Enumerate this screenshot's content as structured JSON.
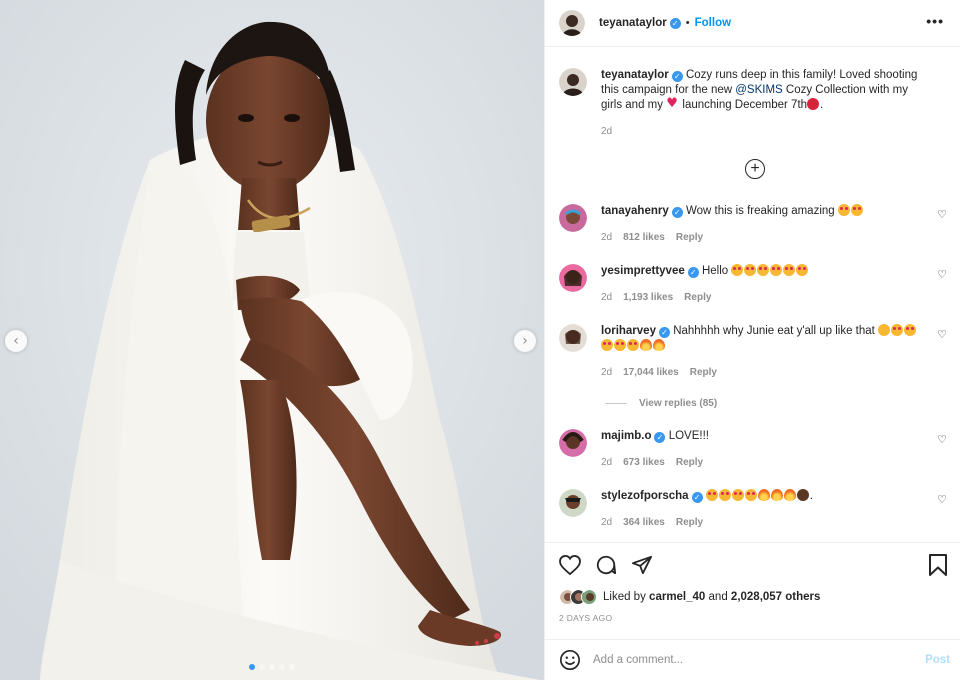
{
  "post": {
    "username": "teyanataylor",
    "follow_label": "Follow",
    "more_label": "•••"
  },
  "caption": {
    "username": "teyanataylor",
    "text_before": "Cozy runs deep in this family! Loved shooting this campaign for the new ",
    "mention": "@SKIMS",
    "text_middle": " Cozy Collection with my girls and my ",
    "text_after": " launching December 7th",
    "end_punct": ".",
    "time": "2d"
  },
  "comments": [
    {
      "username": "tanayahenry",
      "text": "Wow this is freaking amazing",
      "emoji": [
        "star-struck",
        "star-struck"
      ],
      "time": "2d",
      "likes": "812 likes",
      "reply": "Reply"
    },
    {
      "username": "yesimprettyvee",
      "text": "Hello",
      "emoji": [
        "star-struck",
        "star-struck",
        "star-struck",
        "star-struck",
        "star-struck",
        "star-struck"
      ],
      "time": "2d",
      "likes": "1,193 likes",
      "reply": "Reply"
    },
    {
      "username": "loriharvey",
      "text": "Nahhhhh why Junie eat y'all up like that",
      "emoji": [
        "astonished",
        "star-struck",
        "star-struck",
        "star-struck",
        "star-struck",
        "star-struck",
        "fire",
        "fire"
      ],
      "time": "2d",
      "likes": "17,044 likes",
      "reply": "Reply"
    },
    {
      "username": "majimb.o",
      "text": "LOVE!!!",
      "emoji": [],
      "time": "2d",
      "likes": "673 likes",
      "reply": "Reply"
    },
    {
      "username": "stylezofporscha",
      "text": "",
      "emoji": [
        "star-struck",
        "star-struck",
        "star-struck",
        "star-struck",
        "fire",
        "fire",
        "fire",
        "woman"
      ],
      "end_punct": ".",
      "time": "2d",
      "likes": "364 likes",
      "reply": "Reply"
    }
  ],
  "view_replies_label": "View replies (85)",
  "liked_by": {
    "prefix": "Liked by ",
    "user": "carmel_40",
    "middle": " and ",
    "count": "2,028,057 others"
  },
  "posted_ago": "2 DAYS AGO",
  "add_comment": {
    "placeholder": "Add a comment...",
    "post_label": "Post"
  },
  "carousel": {
    "current_index": 0,
    "total": 5
  },
  "colors": {
    "accent": "#0095f6",
    "verified": "#3897f0",
    "post_disabled": "#b2dffc",
    "heart": "#e0245e"
  },
  "icons": [
    "verified-badge",
    "heart-outline-icon",
    "comment-icon",
    "share-icon",
    "bookmark-icon",
    "emoji-icon",
    "plus-circle-icon",
    "chevron-left-icon",
    "chevron-right-icon"
  ]
}
